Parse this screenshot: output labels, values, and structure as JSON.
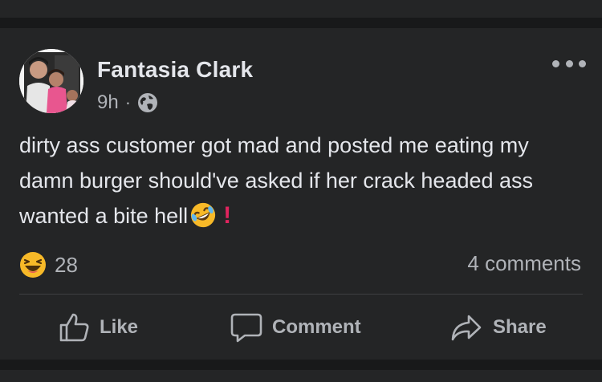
{
  "post": {
    "author": "Fantasia Clark",
    "time": "9h",
    "separator": "·",
    "audience_icon": "globe-icon",
    "text_main": "dirty ass customer got mad and posted me eating my damn burger should've asked if her crack headed ass wanted a bite hell",
    "text_emojis": [
      "rolling-on-the-floor-laughing-emoji",
      "red-exclamation-mark-emoji"
    ],
    "excl": "!",
    "reaction_icon": "laughing-face-icon",
    "reaction_count": "28",
    "comments_count": "4 comments"
  },
  "actions": {
    "like": "Like",
    "comment": "Comment",
    "share": "Share"
  },
  "colors": {
    "background": "#18191a",
    "card": "#242526",
    "primary_text": "#e4e6eb",
    "secondary_text": "#b0b3b8",
    "laugh_yellow": "#f7b928"
  }
}
